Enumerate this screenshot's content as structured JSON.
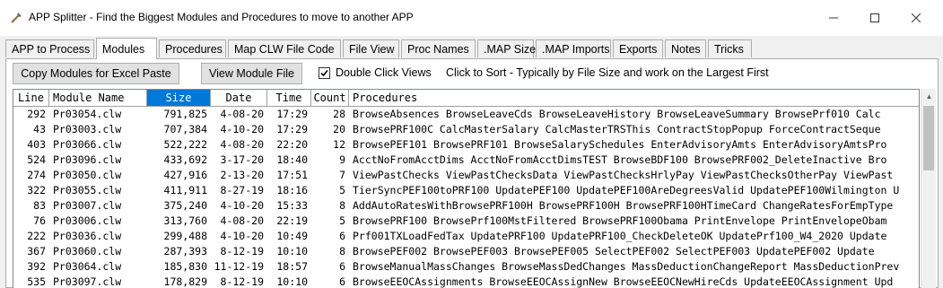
{
  "window": {
    "title": "APP Splitter - Find the Biggest Modules and Procedures to move to another APP"
  },
  "tabs": [
    {
      "label": "APP to Process"
    },
    {
      "label": "Modules",
      "active": true
    },
    {
      "label": "Procedures"
    },
    {
      "label": "Map CLW File Code"
    },
    {
      "label": "File View"
    },
    {
      "label": "Proc Names"
    },
    {
      "label": ".MAP Size"
    },
    {
      "label": ".MAP Imports"
    },
    {
      "label": "Exports"
    },
    {
      "label": "Notes"
    },
    {
      "label": "Tricks"
    }
  ],
  "toolbar": {
    "copy_label": "Copy Modules for Excel Paste",
    "view_label": "View Module File",
    "dblclick_label": "Double Click Views",
    "dblclick_checked": true,
    "hint": "Click to Sort - Typically by File Size and work on the Largest First"
  },
  "columns": [
    {
      "label": "Line"
    },
    {
      "label": "Module Name"
    },
    {
      "label": "Size",
      "sorted": true
    },
    {
      "label": "Date"
    },
    {
      "label": "Time"
    },
    {
      "label": "Count"
    },
    {
      "label": "Procedures"
    }
  ],
  "rows": [
    {
      "line": "292",
      "module": "Pr03054.clw",
      "size": "791,825",
      "date": "4-08-20",
      "time": "17:29",
      "count": "28",
      "procs": "BrowseAbsences  BrowseLeaveCds  BrowseLeaveHistory  BrowseLeaveSummary  BrowsePrf010  Calc"
    },
    {
      "line": "43",
      "module": "Pr03003.clw",
      "size": "707,384",
      "date": "4-10-20",
      "time": "17:29",
      "count": "20",
      "procs": "BrowsePRF100C  CalcMasterSalary  CalcMasterTRSThis  ContractStopPopup  ForceContractSeque"
    },
    {
      "line": "403",
      "module": "Pr03066.clw",
      "size": "522,222",
      "date": "4-08-20",
      "time": "22:20",
      "count": "12",
      "procs": "BrowsePEF101  BrowsePRF101  BrowseSalarySchedules  EnterAdvisoryAmts  EnterAdvisoryAmtsPro"
    },
    {
      "line": "524",
      "module": "Pr03096.clw",
      "size": "433,692",
      "date": "3-17-20",
      "time": "18:40",
      "count": "9",
      "procs": "AcctNoFromAcctDims  AcctNoFromAcctDimsTEST  BrowseBDF100  BrowsePRF002_DeleteInactive  Bro"
    },
    {
      "line": "274",
      "module": "Pr03050.clw",
      "size": "427,916",
      "date": "2-13-20",
      "time": "17:51",
      "count": "7",
      "procs": "ViewPastChecks  ViewPastChecksData  ViewPastChecksHrlyPay  ViewPastChecksOtherPay  ViewPast"
    },
    {
      "line": "322",
      "module": "Pr03055.clw",
      "size": "411,911",
      "date": "8-27-19",
      "time": "18:16",
      "count": "5",
      "procs": "TierSyncPEF100toPRF100  UpdatePEF100  UpdatePEF100AreDegreesValid  UpdatePEF100Wilmington  U"
    },
    {
      "line": "83",
      "module": "Pr03007.clw",
      "size": "375,240",
      "date": "4-10-20",
      "time": "15:33",
      "count": "8",
      "procs": "AddAutoRatesWithBrowsePRF100H  BrowsePRF100H  BrowsePRF100HTimeCard  ChangeRatesForEmpType"
    },
    {
      "line": "76",
      "module": "Pr03006.clw",
      "size": "313,760",
      "date": "4-08-20",
      "time": "22:19",
      "count": "5",
      "procs": "BrowsePRF100  BrowsePrf100MstFiltered  BrowsePRF100Obama  PrintEnvelope  PrintEnvelopeObam"
    },
    {
      "line": "222",
      "module": "Pr03036.clw",
      "size": "299,488",
      "date": "4-10-20",
      "time": "10:49",
      "count": "6",
      "procs": "Prf001TXLoadFedTax  UpdatePRF100  UpdatePRF100_CheckDeleteOK  UpdatePrf100_W4_2020  Update"
    },
    {
      "line": "367",
      "module": "Pr03060.clw",
      "size": "287,393",
      "date": "8-12-19",
      "time": "10:10",
      "count": "8",
      "procs": "BrowsePEF002  BrowsePEF003  BrowsePEF005  SelectPEF002  SelectPEF003  UpdatePEF002  Update"
    },
    {
      "line": "392",
      "module": "Pr03064.clw",
      "size": "185,830",
      "date": "11-12-19",
      "time": "18:57",
      "count": "6",
      "procs": "BrowseManualMassChanges  BrowseMassDedChanges  MassDeductionChangeReport  MassDeductionPrev"
    },
    {
      "line": "535",
      "module": "Pr03097.clw",
      "size": "178,829",
      "date": "8-12-19",
      "time": "10:10",
      "count": "6",
      "procs": "BrowseEEOCAssignments  BrowseEEOCAssignNew  BrowseEEOCNewHireCds  UpdateEEOCAssignment  Upd"
    }
  ]
}
